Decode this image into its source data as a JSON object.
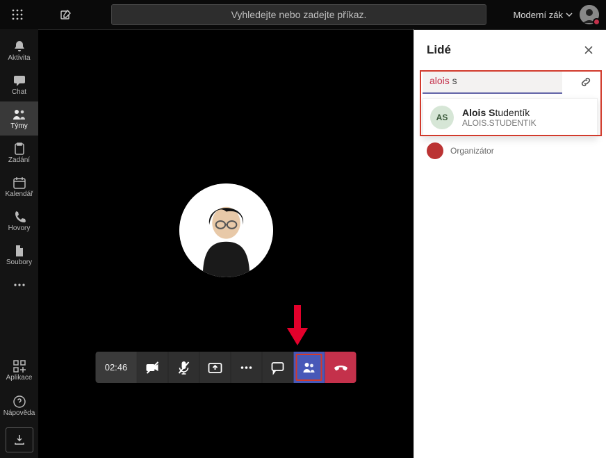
{
  "topbar": {
    "search_placeholder": "Vyhledejte nebo zadejte příkaz.",
    "profile_label": "Moderní zák"
  },
  "rail": {
    "activity": "Aktivita",
    "chat": "Chat",
    "teams": "Týmy",
    "assignments": "Zadání",
    "calendar": "Kalendář",
    "calls": "Hovory",
    "files": "Soubory",
    "apps": "Aplikace",
    "help": "Nápověda"
  },
  "call": {
    "duration": "02:46"
  },
  "people": {
    "title": "Lidé",
    "search_value": "alois s",
    "search_match": "alois",
    "search_rest": " s",
    "suggestion": {
      "initials": "AS",
      "name_bold": "Alois S",
      "name_rest": "tudentík",
      "subtitle": "ALOIS.STUDENTIK"
    },
    "organizer_label": "Organizátor"
  }
}
